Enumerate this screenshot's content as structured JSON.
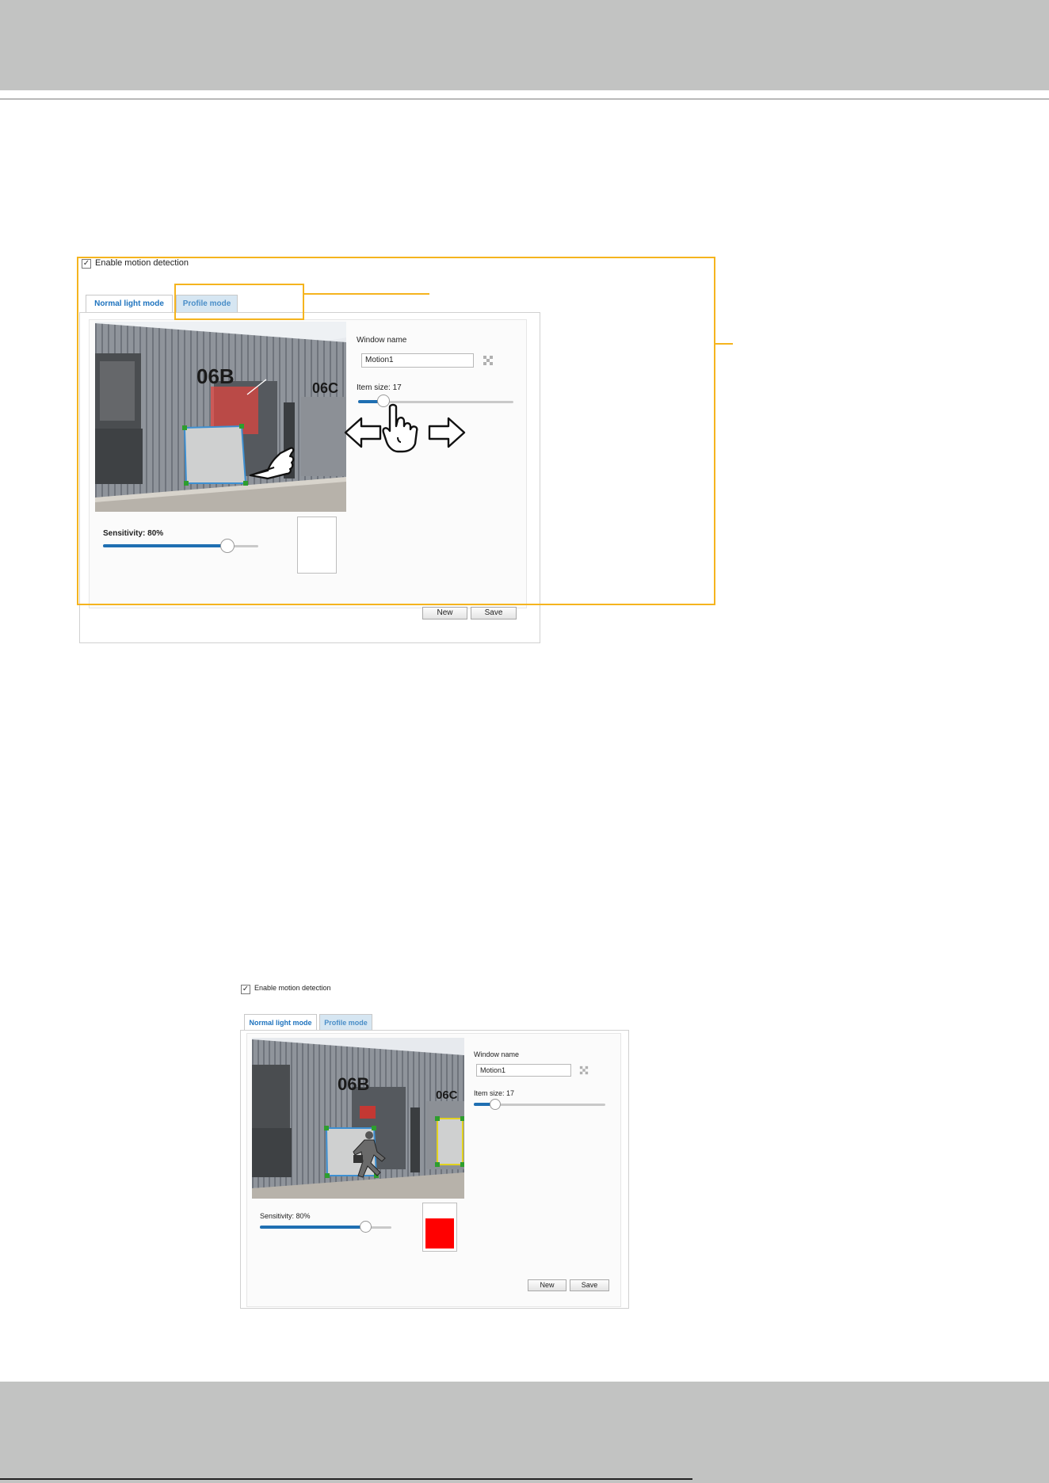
{
  "panel1": {
    "checkbox_label": "Enable motion detection",
    "checkbox_mark": "✓",
    "tabs": {
      "normal": "Normal light mode",
      "profile": "Profile mode"
    },
    "window_name_label": "Window name",
    "window_name_value": "Motion1",
    "item_size_label": "Item size: 17",
    "sensitivity_label": "Sensitivity: 80%",
    "sensitivity_level": 0.8,
    "scene_labels": {
      "bay_b": "06B",
      "bay_c": "06C"
    },
    "buttons": {
      "new": "New",
      "save": "Save"
    }
  },
  "panel2": {
    "checkbox_label": "Enable motion detection",
    "checkbox_mark": "✓",
    "tabs": {
      "normal": "Normal light mode",
      "profile": "Profile mode"
    },
    "window_name_label": "Window name",
    "window_name_value": "Motion1",
    "item_size_label": "Item size: 17",
    "sensitivity_label": "Sensitivity: 80%",
    "sensitivity_level": 0.8,
    "scene_labels": {
      "bay_b": "06B",
      "bay_c": "06C"
    },
    "buttons": {
      "new": "New",
      "save": "Save"
    }
  },
  "colors": {
    "callout": "#f5b41e",
    "header_band": "#c2c3c2",
    "tab_link": "#1e73be",
    "slider_fill": "#1f6fb2",
    "motion_alert": "#ff0000",
    "window_outline": "#3d8fd1",
    "window_handle": "#2e9e2e"
  },
  "icons": [
    "checkbox-checked-icon",
    "delete-window-icon",
    "pointing-hand-icon",
    "left-arrow-icon",
    "right-arrow-icon",
    "running-man-icon"
  ]
}
